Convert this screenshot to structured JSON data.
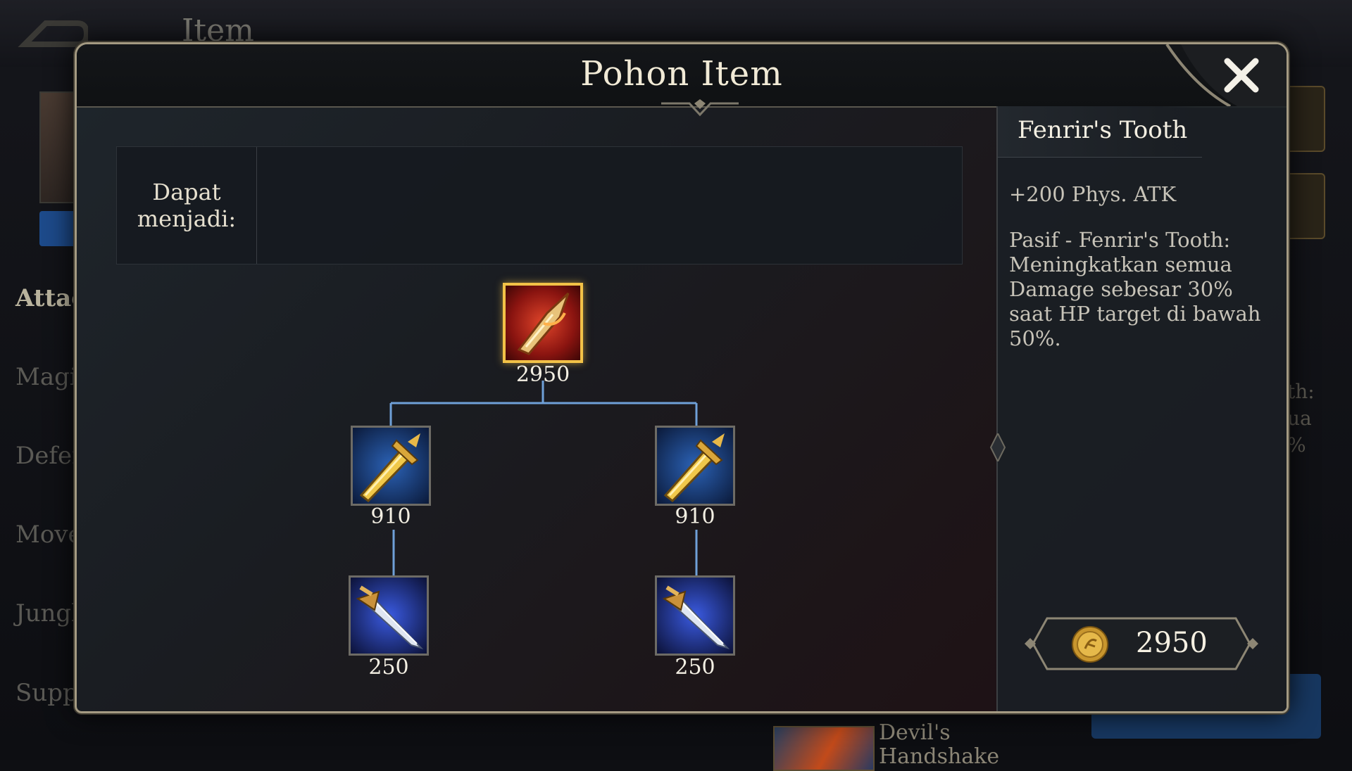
{
  "background": {
    "header_title": "Item",
    "categories": [
      "Attac",
      "Magic",
      "Defen",
      "Move",
      "Jungl",
      "Supp"
    ],
    "active_category_index": 0,
    "right_fragment_lines": [
      "th:",
      "ua",
      "%"
    ],
    "bottom_item_name": "Devil's Handshake"
  },
  "modal": {
    "title": "Pohon Item",
    "close_icon": "close-icon",
    "become_label": "Dapat menjadi:",
    "tree": {
      "root": {
        "cost": "2950",
        "icon": "fenrirs-tooth-icon",
        "selected": true
      },
      "level2": [
        {
          "cost": "910",
          "icon": "golden-sword-icon"
        },
        {
          "cost": "910",
          "icon": "golden-sword-icon"
        }
      ],
      "level3": [
        {
          "cost": "250",
          "icon": "dagger-icon"
        },
        {
          "cost": "250",
          "icon": "dagger-icon"
        }
      ]
    },
    "detail": {
      "name": "Fenrir's Tooth",
      "stat": "+200 Phys. ATK",
      "passive": "Pasif - Fenrir's Tooth: Meningkatkan semua Damage sebesar 30% saat HP target di bawah 50%.",
      "price": "2950",
      "price_icon": "gold-coin-icon"
    }
  },
  "colors": {
    "selected_border": "#f2c247",
    "connector": "#6fa0d8",
    "text_primary": "#f1ead6"
  }
}
